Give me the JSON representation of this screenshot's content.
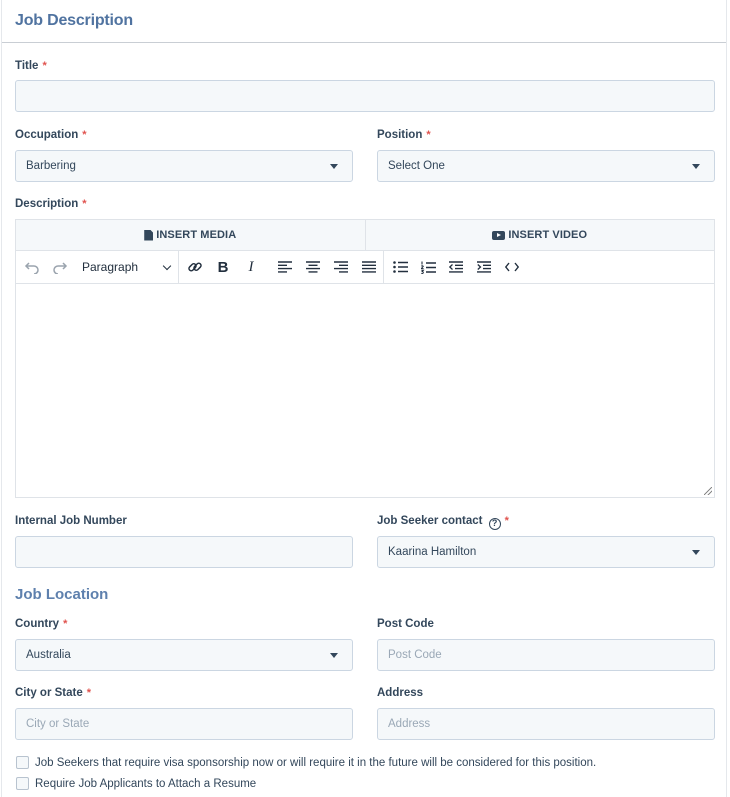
{
  "header": {
    "title": "Job Description"
  },
  "fields": {
    "title": {
      "label": "Title",
      "required_mark": "*",
      "value": ""
    },
    "occupation": {
      "label": "Occupation",
      "required_mark": "*",
      "value": "Barbering"
    },
    "position": {
      "label": "Position",
      "required_mark": "*",
      "value": "Select One"
    },
    "description": {
      "label": "Description",
      "required_mark": "*"
    },
    "internal_job_number": {
      "label": "Internal Job Number",
      "value": ""
    },
    "job_seeker_contact": {
      "label": "Job Seeker contact",
      "help_icon": "?",
      "required_mark": "*",
      "value": "Kaarina Hamilton"
    }
  },
  "editor": {
    "insert_media": "INSERT MEDIA",
    "insert_video": "INSERT VIDEO",
    "block_format": "Paragraph",
    "toolbar_icons": [
      "undo-icon",
      "redo-icon",
      "link-icon",
      "bold-icon",
      "italic-icon",
      "align-left-icon",
      "align-center-icon",
      "align-right-icon",
      "align-justify-icon",
      "bullet-list-icon",
      "numbered-list-icon",
      "outdent-icon",
      "indent-icon",
      "code-icon"
    ],
    "bold_glyph": "B",
    "italic_glyph": "I",
    "content": ""
  },
  "location": {
    "section_title": "Job Location",
    "country": {
      "label": "Country",
      "required_mark": "*",
      "value": "Australia"
    },
    "post_code": {
      "label": "Post Code",
      "placeholder": "Post Code"
    },
    "city_state": {
      "label": "City or State",
      "required_mark": "*",
      "placeholder": "City or State"
    },
    "address": {
      "label": "Address",
      "placeholder": "Address"
    }
  },
  "checkboxes": {
    "visa": {
      "label": "Job Seekers that require visa sponsorship now or will require it in the future will be considered for this position.",
      "checked": false
    },
    "resume": {
      "label": "Require Job Applicants to Attach a Resume",
      "checked": false
    }
  },
  "colors": {
    "heading": "#5073a0",
    "required": "#e0524d",
    "field_bg": "#f5f8fa",
    "field_border": "#cbd6e2"
  }
}
